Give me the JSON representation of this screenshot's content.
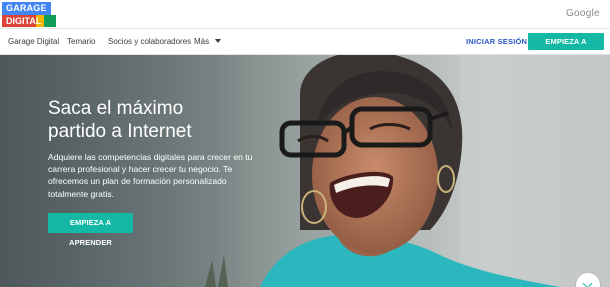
{
  "brand": {
    "logo_line1": "GARAGE",
    "logo_line2": "DIGITAL",
    "google_word": "Google"
  },
  "nav": {
    "items": [
      "Garage Digital",
      "Temario",
      "Socios y colaboradores",
      "Más"
    ],
    "signin_label": "INICIAR SESIÓN",
    "cta_label": "EMPIEZA A APRENDER"
  },
  "hero": {
    "title_line1": "Saca el máximo",
    "title_line2": "partido a Internet",
    "description": "Adquiere las competencias digitales para crecer en tu carrera profesional y hacer crecer tu negocio. Te ofrecemos un plan de formación personalizado totalmente gratis.",
    "cta_label": "EMPIEZA A APRENDER"
  },
  "colors": {
    "accent": "#15b8a4",
    "signin": "#2a56c6",
    "logo_blue": "#4285f4",
    "logo_red": "#db4437",
    "logo_yellow": "#f4b400",
    "logo_green": "#0f9d58"
  },
  "icons": {
    "scroll_down": "chevron-down-icon",
    "more_menu": "caret-down-icon"
  }
}
